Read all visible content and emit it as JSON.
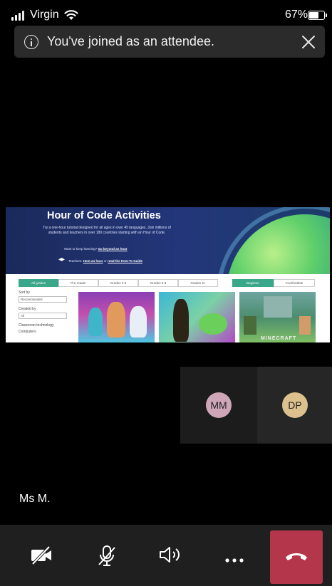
{
  "status_bar": {
    "carrier": "Virgin",
    "battery_percent": "67%",
    "battery_level": 0.67
  },
  "banner": {
    "message": "You've joined as an attendee."
  },
  "shared_screen": {
    "title": "Hour of Code Activities",
    "tagline": "Try a one-hour tutorial designed for all ages in over 45 languages. Join millions of students and teachers in over 180 countries starting with an Hour of Code.",
    "keep_learning_prefix": "Want to keep learning?",
    "keep_learning_link": "Go beyond an hour",
    "teachers_prefix": "Teachers:",
    "teachers_link_1": "Host an hour",
    "teachers_or": "or",
    "teachers_link_2": "read the How-To Guide",
    "grades": [
      "All grades",
      "Pre-reader",
      "Grades 2-5",
      "Grades 6-8",
      "Grades 9+"
    ],
    "levels": [
      "Beginner",
      "Comfortable"
    ],
    "filters": {
      "sort_label": "Sort by",
      "sort_value": "Recommended",
      "created_label": "Created by",
      "created_value": "All",
      "classroom_label": "Classroom technology",
      "classroom_option": "Computers"
    },
    "card3_text": "MINECRAFT"
  },
  "participants": [
    {
      "initials": "MM",
      "color": "#cfa6b8"
    },
    {
      "initials": "DP",
      "color": "#dcc18e"
    }
  ],
  "presenter_name": "Ms M.",
  "controls": {
    "video_icon": "video-off-icon",
    "mic_icon": "mic-off-icon",
    "speaker_icon": "speaker-icon",
    "more_icon": "more-icon",
    "end_icon": "phone-hangup-icon",
    "end_color": "#b3364a"
  }
}
